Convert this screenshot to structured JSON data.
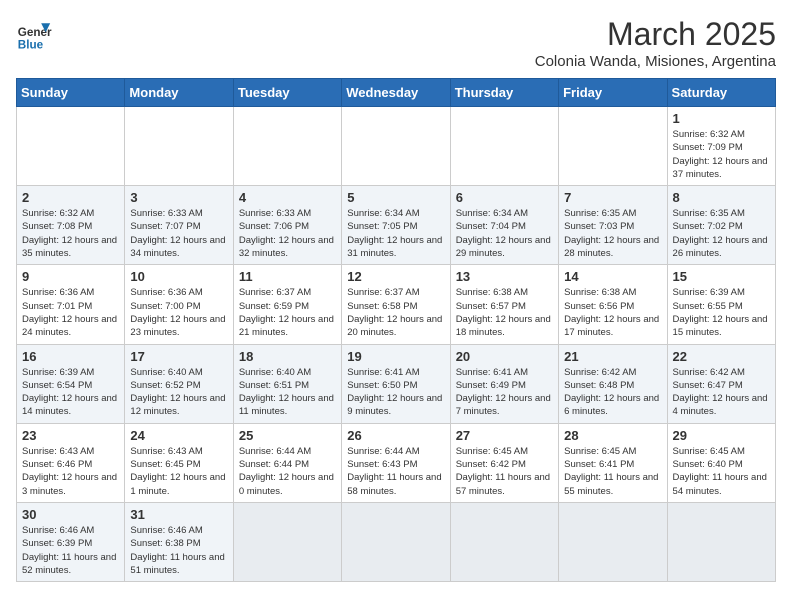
{
  "header": {
    "logo_general": "General",
    "logo_blue": "Blue",
    "month_title": "March 2025",
    "subtitle": "Colonia Wanda, Misiones, Argentina"
  },
  "days_of_week": [
    "Sunday",
    "Monday",
    "Tuesday",
    "Wednesday",
    "Thursday",
    "Friday",
    "Saturday"
  ],
  "weeks": [
    [
      {
        "day": "",
        "info": ""
      },
      {
        "day": "",
        "info": ""
      },
      {
        "day": "",
        "info": ""
      },
      {
        "day": "",
        "info": ""
      },
      {
        "day": "",
        "info": ""
      },
      {
        "day": "",
        "info": ""
      },
      {
        "day": "1",
        "info": "Sunrise: 6:32 AM\nSunset: 7:09 PM\nDaylight: 12 hours and 37 minutes."
      }
    ],
    [
      {
        "day": "2",
        "info": "Sunrise: 6:32 AM\nSunset: 7:08 PM\nDaylight: 12 hours and 35 minutes."
      },
      {
        "day": "3",
        "info": "Sunrise: 6:33 AM\nSunset: 7:07 PM\nDaylight: 12 hours and 34 minutes."
      },
      {
        "day": "4",
        "info": "Sunrise: 6:33 AM\nSunset: 7:06 PM\nDaylight: 12 hours and 32 minutes."
      },
      {
        "day": "5",
        "info": "Sunrise: 6:34 AM\nSunset: 7:05 PM\nDaylight: 12 hours and 31 minutes."
      },
      {
        "day": "6",
        "info": "Sunrise: 6:34 AM\nSunset: 7:04 PM\nDaylight: 12 hours and 29 minutes."
      },
      {
        "day": "7",
        "info": "Sunrise: 6:35 AM\nSunset: 7:03 PM\nDaylight: 12 hours and 28 minutes."
      },
      {
        "day": "8",
        "info": "Sunrise: 6:35 AM\nSunset: 7:02 PM\nDaylight: 12 hours and 26 minutes."
      }
    ],
    [
      {
        "day": "9",
        "info": "Sunrise: 6:36 AM\nSunset: 7:01 PM\nDaylight: 12 hours and 24 minutes."
      },
      {
        "day": "10",
        "info": "Sunrise: 6:36 AM\nSunset: 7:00 PM\nDaylight: 12 hours and 23 minutes."
      },
      {
        "day": "11",
        "info": "Sunrise: 6:37 AM\nSunset: 6:59 PM\nDaylight: 12 hours and 21 minutes."
      },
      {
        "day": "12",
        "info": "Sunrise: 6:37 AM\nSunset: 6:58 PM\nDaylight: 12 hours and 20 minutes."
      },
      {
        "day": "13",
        "info": "Sunrise: 6:38 AM\nSunset: 6:57 PM\nDaylight: 12 hours and 18 minutes."
      },
      {
        "day": "14",
        "info": "Sunrise: 6:38 AM\nSunset: 6:56 PM\nDaylight: 12 hours and 17 minutes."
      },
      {
        "day": "15",
        "info": "Sunrise: 6:39 AM\nSunset: 6:55 PM\nDaylight: 12 hours and 15 minutes."
      }
    ],
    [
      {
        "day": "16",
        "info": "Sunrise: 6:39 AM\nSunset: 6:54 PM\nDaylight: 12 hours and 14 minutes."
      },
      {
        "day": "17",
        "info": "Sunrise: 6:40 AM\nSunset: 6:52 PM\nDaylight: 12 hours and 12 minutes."
      },
      {
        "day": "18",
        "info": "Sunrise: 6:40 AM\nSunset: 6:51 PM\nDaylight: 12 hours and 11 minutes."
      },
      {
        "day": "19",
        "info": "Sunrise: 6:41 AM\nSunset: 6:50 PM\nDaylight: 12 hours and 9 minutes."
      },
      {
        "day": "20",
        "info": "Sunrise: 6:41 AM\nSunset: 6:49 PM\nDaylight: 12 hours and 7 minutes."
      },
      {
        "day": "21",
        "info": "Sunrise: 6:42 AM\nSunset: 6:48 PM\nDaylight: 12 hours and 6 minutes."
      },
      {
        "day": "22",
        "info": "Sunrise: 6:42 AM\nSunset: 6:47 PM\nDaylight: 12 hours and 4 minutes."
      }
    ],
    [
      {
        "day": "23",
        "info": "Sunrise: 6:43 AM\nSunset: 6:46 PM\nDaylight: 12 hours and 3 minutes."
      },
      {
        "day": "24",
        "info": "Sunrise: 6:43 AM\nSunset: 6:45 PM\nDaylight: 12 hours and 1 minute."
      },
      {
        "day": "25",
        "info": "Sunrise: 6:44 AM\nSunset: 6:44 PM\nDaylight: 12 hours and 0 minutes."
      },
      {
        "day": "26",
        "info": "Sunrise: 6:44 AM\nSunset: 6:43 PM\nDaylight: 11 hours and 58 minutes."
      },
      {
        "day": "27",
        "info": "Sunrise: 6:45 AM\nSunset: 6:42 PM\nDaylight: 11 hours and 57 minutes."
      },
      {
        "day": "28",
        "info": "Sunrise: 6:45 AM\nSunset: 6:41 PM\nDaylight: 11 hours and 55 minutes."
      },
      {
        "day": "29",
        "info": "Sunrise: 6:45 AM\nSunset: 6:40 PM\nDaylight: 11 hours and 54 minutes."
      }
    ],
    [
      {
        "day": "30",
        "info": "Sunrise: 6:46 AM\nSunset: 6:39 PM\nDaylight: 11 hours and 52 minutes."
      },
      {
        "day": "31",
        "info": "Sunrise: 6:46 AM\nSunset: 6:38 PM\nDaylight: 11 hours and 51 minutes."
      },
      {
        "day": "",
        "info": ""
      },
      {
        "day": "",
        "info": ""
      },
      {
        "day": "",
        "info": ""
      },
      {
        "day": "",
        "info": ""
      },
      {
        "day": "",
        "info": ""
      }
    ]
  ]
}
